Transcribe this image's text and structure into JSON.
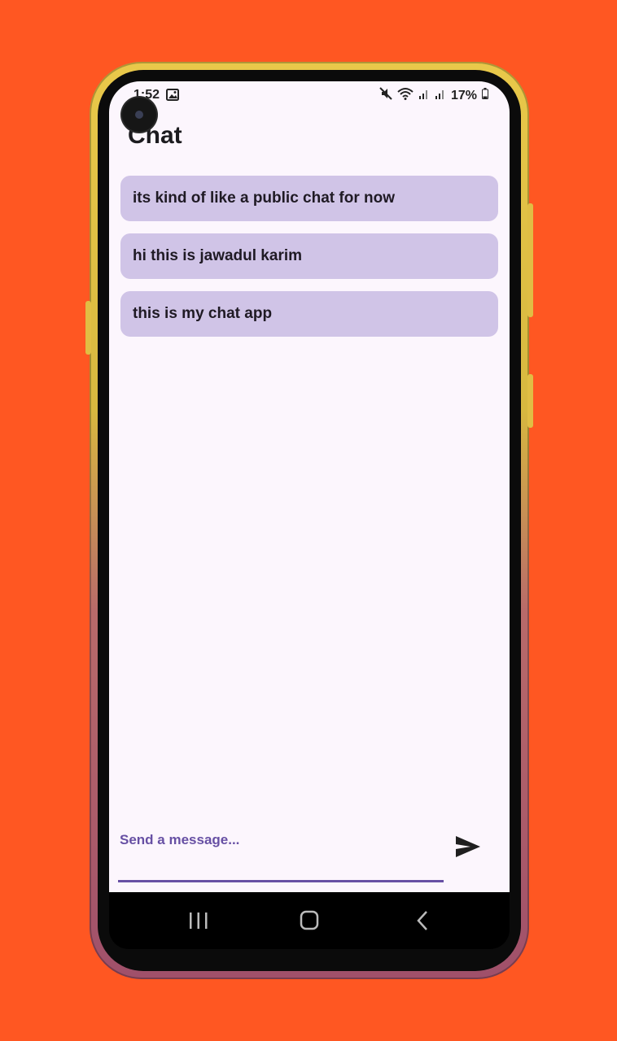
{
  "status_bar": {
    "time": "1:52",
    "battery": "17%",
    "icons": [
      "gallery-icon",
      "mute-icon",
      "wifi-icon",
      "signal-icon",
      "signal-icon",
      "battery-icon"
    ]
  },
  "header": {
    "title": "Chat"
  },
  "messages": [
    {
      "text": "its kind of like a public chat for now"
    },
    {
      "text": "hi this is jawadul karim"
    },
    {
      "text": "this is my chat app"
    }
  ],
  "composer": {
    "placeholder": "Send a message...",
    "value": "",
    "send_icon": "send-icon"
  },
  "nav_bar": {
    "icons": [
      "recents-icon",
      "home-icon",
      "back-icon"
    ]
  },
  "colors": {
    "background": "#FF5722",
    "screen": "#FCF6FD",
    "bubble": "#D0C4E7",
    "accent": "#6750A4",
    "text": "#1C1B1F"
  }
}
